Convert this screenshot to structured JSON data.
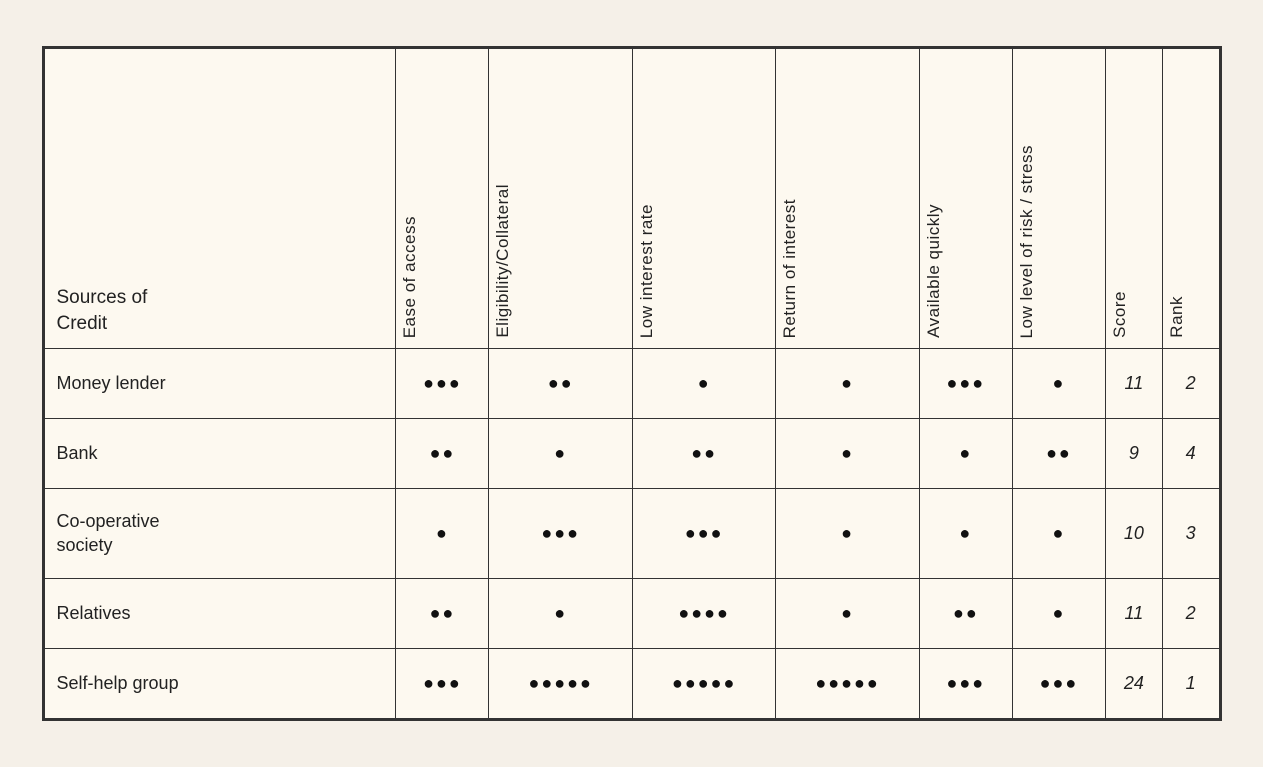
{
  "header": {
    "source_label": "Sources of\nCredit",
    "columns": [
      {
        "id": "ease",
        "label": "Ease of access"
      },
      {
        "id": "eligibility",
        "label": "Eligibility/Collateral"
      },
      {
        "id": "low_interest",
        "label": "Low interest rate"
      },
      {
        "id": "return",
        "label": "Return of interest"
      },
      {
        "id": "available",
        "label": "Available quickly"
      },
      {
        "id": "risk",
        "label": "Low level of risk / stress"
      },
      {
        "id": "score",
        "label": "Score"
      },
      {
        "id": "rank",
        "label": "Rank"
      }
    ]
  },
  "rows": [
    {
      "source": "Money lender",
      "ease": "●●●",
      "eligibility": "●●",
      "low_interest": "●",
      "return": "●",
      "available": "●●●",
      "risk": "●",
      "score": "11",
      "rank": "2"
    },
    {
      "source": "Bank",
      "ease": "●●",
      "eligibility": "●",
      "low_interest": "●●",
      "return": "●",
      "available": "●",
      "risk": "●●",
      "score": "9",
      "rank": "4"
    },
    {
      "source": "Co-operative\nsociety",
      "ease": "●",
      "eligibility": "●●●",
      "low_interest": "●●●",
      "return": "●",
      "available": "●",
      "risk": "●",
      "score": "10",
      "rank": "3"
    },
    {
      "source": "Relatives",
      "ease": "●●",
      "eligibility": "●",
      "low_interest": "●●●●",
      "return": "●",
      "available": "●●",
      "risk": "●",
      "score": "11",
      "rank": "2"
    },
    {
      "source": "Self-help group",
      "ease": "●●●",
      "eligibility": "●●●●●",
      "low_interest": "●●●●●",
      "return": "●●●●●",
      "available": "●●●",
      "risk": "●●●",
      "score": "24",
      "rank": "1"
    }
  ]
}
